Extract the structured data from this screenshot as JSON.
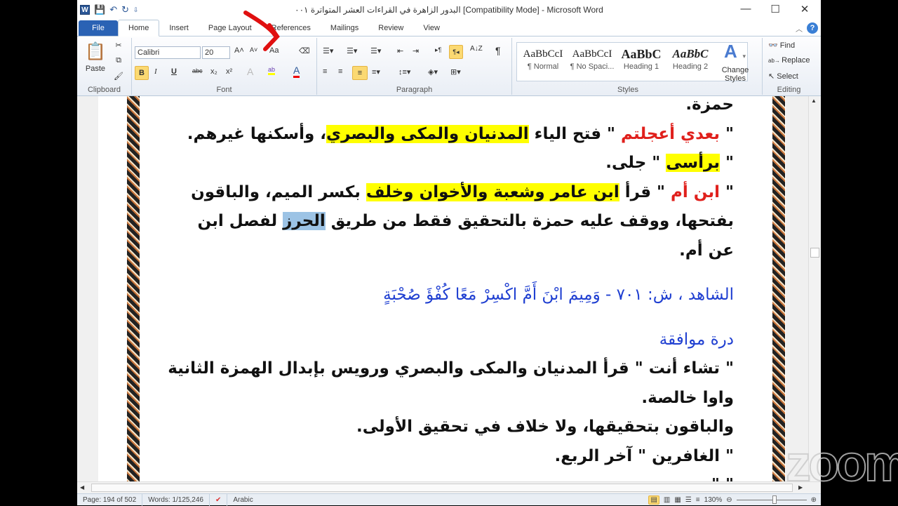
{
  "window": {
    "title": "البدور الزاهرة في القراءات العشر المتواترة ٠٠١ [Compatibility Mode] - Microsoft Word",
    "minimize": "—",
    "maximize": "☐",
    "close": "✕"
  },
  "qat": {
    "logo": "W",
    "save": "💾",
    "undo": "↶",
    "redo": "↻",
    "customize": "⇩"
  },
  "tabs": [
    "File",
    "Home",
    "Insert",
    "Page Layout",
    "References",
    "Mailings",
    "Review",
    "View"
  ],
  "ribbon": {
    "clipboard": {
      "label": "Clipboard",
      "paste": "Paste"
    },
    "font": {
      "label": "Font",
      "name": "Calibri",
      "size": "20",
      "grow": "A˄",
      "shrink": "A˅",
      "case": "Aa",
      "bold": "B",
      "italic": "I",
      "underline": "U",
      "strike": "abc",
      "sub": "x₂",
      "sup": "x²",
      "effects": "A",
      "highlight": "ab",
      "color": "A"
    },
    "paragraph": {
      "label": "Paragraph",
      "pilcrow": "¶",
      "sort": "A↓Z"
    },
    "styles": {
      "label": "Styles",
      "items": [
        {
          "preview": "AaBbCcI",
          "name": "¶ Normal"
        },
        {
          "preview": "AaBbCcI",
          "name": "¶ No Spaci..."
        },
        {
          "preview": "AaBbC",
          "name": "Heading 1"
        },
        {
          "preview": "AaBbC",
          "name": "Heading 2"
        }
      ],
      "change": "Change Styles"
    },
    "editing": {
      "label": "Editing",
      "find": "Find",
      "replace": "Replace",
      "select": "Select"
    }
  },
  "document": {
    "lines": [
      [
        {
          "t": "حمزة.",
          "c": ""
        }
      ],
      [
        {
          "t": "\" ",
          "c": ""
        },
        {
          "t": "بعدي أعجلتم",
          "c": "red"
        },
        {
          "t": " \" فتح الياء ",
          "c": ""
        },
        {
          "t": "المدنيان والمكى والبصري",
          "c": "yel"
        },
        {
          "t": "، وأسكنها غيرهم.",
          "c": ""
        }
      ],
      [
        {
          "t": "\" ",
          "c": ""
        },
        {
          "t": "برأسى",
          "c": "yel"
        },
        {
          "t": " \" جلى.",
          "c": ""
        }
      ],
      [
        {
          "t": "\" ",
          "c": ""
        },
        {
          "t": "ابن أم",
          "c": "red"
        },
        {
          "t": " \" قرأ ",
          "c": ""
        },
        {
          "t": "ابن عامر وشعبة والأخوان وخلف",
          "c": "yel"
        },
        {
          "t": " بكسر الميم، والباقون",
          "c": ""
        }
      ],
      [
        {
          "t": "بفتحها، ووقف عليه حمزة بالتحقيق فقط من طريق ",
          "c": ""
        },
        {
          "t": "الحرز",
          "c": "selc"
        },
        {
          "t": " لفصل ابن",
          "c": ""
        }
      ],
      [
        {
          "t": "عن أم.",
          "c": ""
        }
      ],
      [],
      [
        {
          "t": "الشاهد ، ش: ٧٠١ - وَمِيمَ ابْنَ أَمَّ اكْسِرْ مَعًا كُفْؤَ صُحْبَةٍ",
          "c": "blue"
        }
      ],
      [],
      [
        {
          "t": "درة موافقة",
          "c": "blue"
        }
      ],
      [
        {
          "t": "\" تشاء أنت \" قرأ المدنيان والمكى والبصري ورويس بإبدال الهمزة الثانية",
          "c": ""
        }
      ],
      [
        {
          "t": "واوا خالصة.",
          "c": ""
        }
      ],
      [
        {
          "t": "والباقون بتحقيقها، ولا خلاف في تحقيق الأولى.",
          "c": ""
        }
      ],
      [
        {
          "t": "\" الغافرين \" آخر الربع.",
          "c": ""
        }
      ],
      [
        {
          "t": "\" \"",
          "c": ""
        }
      ]
    ]
  },
  "status": {
    "page": "Page: 194 of 502",
    "words": "Words: 1/125,246",
    "language": "Arabic",
    "zoom": "130%",
    "zoom_fraction": 0.55
  },
  "watermark": "zoom"
}
